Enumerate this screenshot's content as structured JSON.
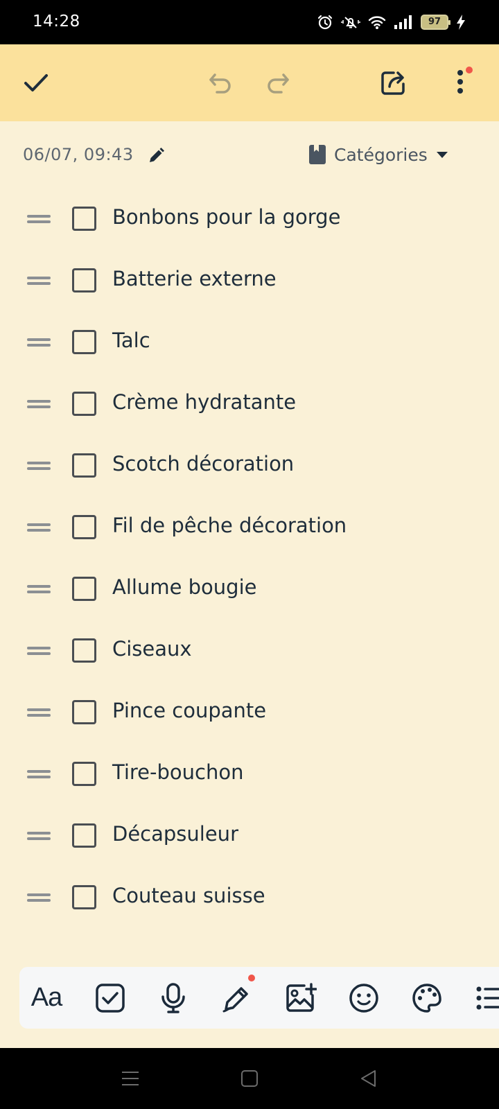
{
  "status_bar": {
    "time": "14:28",
    "battery": "97",
    "icons": [
      "alarm-icon",
      "vibrate-off-icon",
      "wifi-icon",
      "signal-icon",
      "battery-icon",
      "charging-icon"
    ]
  },
  "toolbar": {
    "icons": [
      "check-icon",
      "undo-icon",
      "redo-icon",
      "share-icon",
      "more-vertical-icon"
    ],
    "background": "#fbe19c",
    "notification_dot_color": "#f0564a"
  },
  "meta": {
    "date": "06/07, 09:43",
    "categories_label": "Catégories"
  },
  "checklist": {
    "items": [
      {
        "label": "Bonbons pour la gorge",
        "checked": false
      },
      {
        "label": "Batterie externe",
        "checked": false
      },
      {
        "label": "Talc",
        "checked": false
      },
      {
        "label": "Crème hydratante",
        "checked": false
      },
      {
        "label": "Scotch décoration",
        "checked": false
      },
      {
        "label": "Fil de pêche décoration",
        "checked": false
      },
      {
        "label": "Allume bougie",
        "checked": false
      },
      {
        "label": "Ciseaux",
        "checked": false
      },
      {
        "label": "Pince coupante",
        "checked": false
      },
      {
        "label": "Tire-bouchon",
        "checked": false
      },
      {
        "label": "Décapsuleur",
        "checked": false
      },
      {
        "label": "Couteau suisse",
        "checked": false
      }
    ]
  },
  "format_bar": {
    "text_format_label": "Aa",
    "icons": [
      "text-format-icon",
      "checkbox-icon",
      "microphone-icon",
      "pen-icon",
      "add-image-icon",
      "emoji-icon",
      "palette-icon",
      "bullet-list-icon"
    ]
  },
  "nav_bar": {
    "icons": [
      "menu-icon",
      "home-icon",
      "back-icon"
    ]
  },
  "colors": {
    "page_background": "#faf1d7",
    "text": "#1e2d3b"
  }
}
